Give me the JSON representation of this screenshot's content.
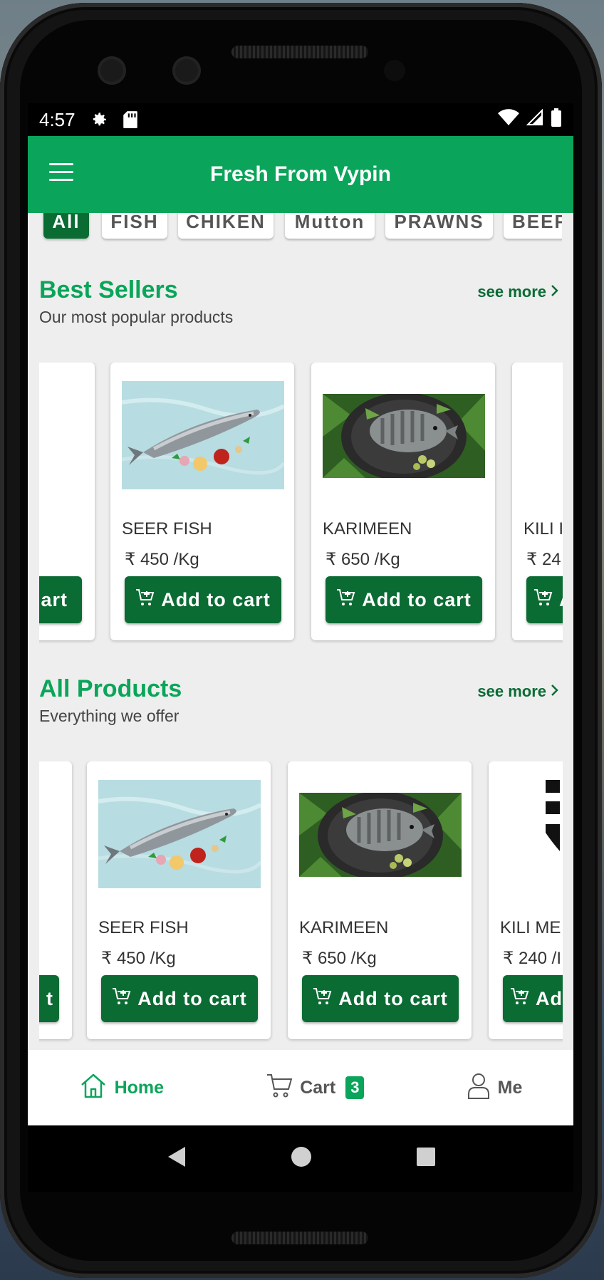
{
  "status_bar": {
    "time": "4:57"
  },
  "app_bar": {
    "title": "Fresh From Vypin"
  },
  "categories": [
    "All",
    "FISH",
    "CHIKEN",
    "Mutton",
    "PRAWNS",
    "BEEF"
  ],
  "best_sellers": {
    "title": "Best Sellers",
    "subtitle": "Our most popular products",
    "see_more": "see more",
    "partial_left_button": "art",
    "items": [
      {
        "name": "SEER FISH",
        "price": "₹ 450 /Kg",
        "button": "Add to cart"
      },
      {
        "name": "KARIMEEN",
        "price": "₹ 650 /Kg",
        "button": "Add to cart"
      },
      {
        "name": "KILI I",
        "price": "₹ 24",
        "button": "A"
      }
    ]
  },
  "all_products": {
    "title": "All Products",
    "subtitle": "Everything we offer",
    "see_more": "see more",
    "partial_left_button": "t",
    "items": [
      {
        "name": "SEER FISH",
        "price": "₹ 450 /Kg",
        "button": "Add to cart"
      },
      {
        "name": "KARIMEEN",
        "price": "₹ 650 /Kg",
        "button": "Add to cart"
      },
      {
        "name": "KILI ME",
        "price": "₹ 240 /I",
        "button": "Ad"
      }
    ]
  },
  "bottom_nav": {
    "home": "Home",
    "cart": "Cart",
    "cart_count": "3",
    "me": "Me"
  },
  "colors": {
    "primary": "#0aa55a",
    "dark_green": "#0a6b33"
  }
}
